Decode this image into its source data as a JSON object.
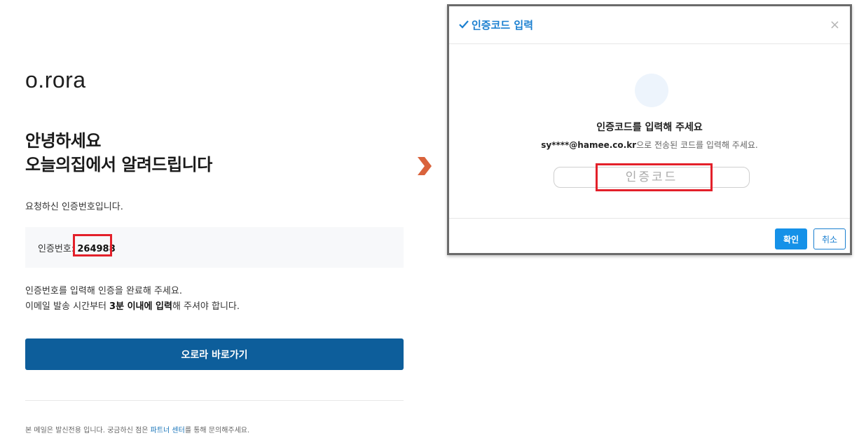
{
  "email": {
    "logo": "o.rora",
    "headline_line1": "안녕하세요",
    "headline_line2": "오늘의집에서 알려드립니다",
    "intro": "요청하신 인증번호입니다.",
    "code_label": "인증번호: ",
    "code_value": "264988",
    "instruction_line1": "인증번호를 입력해 인증을 완료해 주세요.",
    "instruction_line2_pre": "이메일 발송 시간부터 ",
    "instruction_line2_bold": "3분 이내에 입력",
    "instruction_line2_post": "해 주셔야 합니다.",
    "cta_label": "오로라 바로가기",
    "footer_pre": "본 메일은 발신전용 입니다. 궁금하신 점은 ",
    "footer_link": "파트너 센터",
    "footer_post": "를 통해 문의해주세요."
  },
  "dialog": {
    "title": "인증코드 입력",
    "close_symbol": "×",
    "heading": "인증코드를 입력해 주세요",
    "sub_email": "sy****@hamee.co.kr",
    "sub_text": "으로 전송된 코드를 입력해 주세요.",
    "input_placeholder": "인증코드",
    "input_value": "",
    "ok_label": "확인",
    "cancel_label": "취소"
  },
  "colors": {
    "cta_bg": "#0d5e9b",
    "highlight": "#e3202a",
    "dialog_accent": "#1a7fd0",
    "ok_bg": "#1591e8",
    "arrow": "#d9633c"
  },
  "icons": {
    "dialog_title_icon": "check-icon",
    "close_icon": "close-icon",
    "arrow_icon": "chevron-right-icon"
  }
}
